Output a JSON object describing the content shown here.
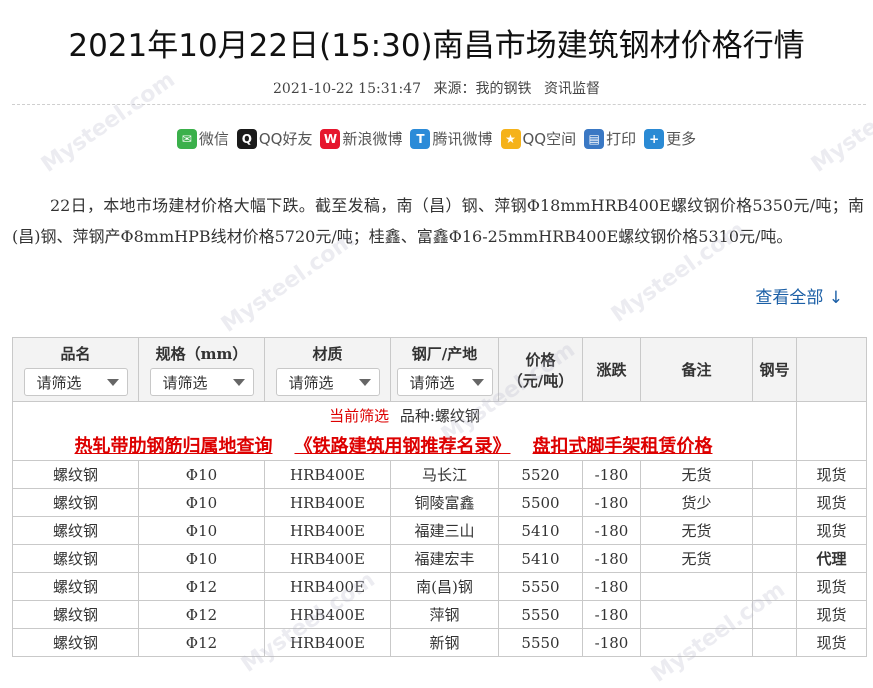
{
  "header": {
    "title": "2021年10月22日(15:30)南昌市场建筑钢材价格行情",
    "datetime": "2021-10-22 15:31:47",
    "source": "来源：我的钢铁",
    "category": "资讯监督"
  },
  "share": [
    {
      "label": "微信",
      "icon": "wechat-icon",
      "color": "#3bb04b",
      "glyph": "✉"
    },
    {
      "label": "QQ好友",
      "icon": "qq-icon",
      "color": "#1a1a1a",
      "glyph": "Q"
    },
    {
      "label": "新浪微博",
      "icon": "weibo-icon",
      "color": "#e6162d",
      "glyph": "W"
    },
    {
      "label": "腾讯微博",
      "icon": "tencent-weibo-icon",
      "color": "#2b8bd8",
      "glyph": "T"
    },
    {
      "label": "QQ空间",
      "icon": "qzone-icon",
      "color": "#f5b21a",
      "glyph": "★"
    },
    {
      "label": "打印",
      "icon": "print-icon",
      "color": "#3a78c4",
      "glyph": "▤"
    },
    {
      "label": "更多",
      "icon": "more-icon",
      "color": "#2a8ad4",
      "glyph": "+"
    }
  ],
  "article": {
    "text": "22日，本地市场建材价格大幅下跌。截至发稿，南（昌）钢、萍钢Φ18mmHRB400E螺纹钢价格5350元/吨；南(昌)钢、萍钢产Φ8mmHPB线材价格5720元/吨；桂鑫、富鑫Φ16-25mmHRB400E螺纹钢价格5310元/吨。",
    "view_all": "查看全部 ↓"
  },
  "table": {
    "headers": {
      "name": "品名",
      "spec": "规格（mm）",
      "material": "材质",
      "origin": "钢厂/产地",
      "price_line1": "价格",
      "price_line2": "（元/吨）",
      "change": "涨跌",
      "note": "备注",
      "steel_no": "钢号"
    },
    "filter_placeholder": "请筛选",
    "current_filter_label": "当前筛选",
    "current_filter_value": "品种:螺纹钢",
    "links": [
      "热轧带肋钢筋归属地查询",
      "《铁路建筑用钢推荐名录》",
      "盘扣式脚手架租赁价格"
    ],
    "rows": [
      {
        "name": "螺纹钢",
        "spec": "Φ10",
        "material": "HRB400E",
        "origin": "马长江",
        "price": "5520",
        "change": "-180",
        "note": "无货",
        "status": "现货",
        "status_red": false
      },
      {
        "name": "螺纹钢",
        "spec": "Φ10",
        "material": "HRB400E",
        "origin": "铜陵富鑫",
        "price": "5500",
        "change": "-180",
        "note": "货少",
        "status": "现货",
        "status_red": false
      },
      {
        "name": "螺纹钢",
        "spec": "Φ10",
        "material": "HRB400E",
        "origin": "福建三山",
        "price": "5410",
        "change": "-180",
        "note": "无货",
        "status": "现货",
        "status_red": false
      },
      {
        "name": "螺纹钢",
        "spec": "Φ10",
        "material": "HRB400E",
        "origin": "福建宏丰",
        "price": "5410",
        "change": "-180",
        "note": "无货",
        "status": "代理",
        "status_red": true
      },
      {
        "name": "螺纹钢",
        "spec": "Φ12",
        "material": "HRB400E",
        "origin": "南(昌)钢",
        "price": "5550",
        "change": "-180",
        "note": "",
        "status": "现货",
        "status_red": false
      },
      {
        "name": "螺纹钢",
        "spec": "Φ12",
        "material": "HRB400E",
        "origin": "萍钢",
        "price": "5550",
        "change": "-180",
        "note": "",
        "status": "现货",
        "status_red": false
      },
      {
        "name": "螺纹钢",
        "spec": "Φ12",
        "material": "HRB400E",
        "origin": "新钢",
        "price": "5550",
        "change": "-180",
        "note": "",
        "status": "现货",
        "status_red": false
      }
    ]
  },
  "watermark": "Mysteel.com"
}
